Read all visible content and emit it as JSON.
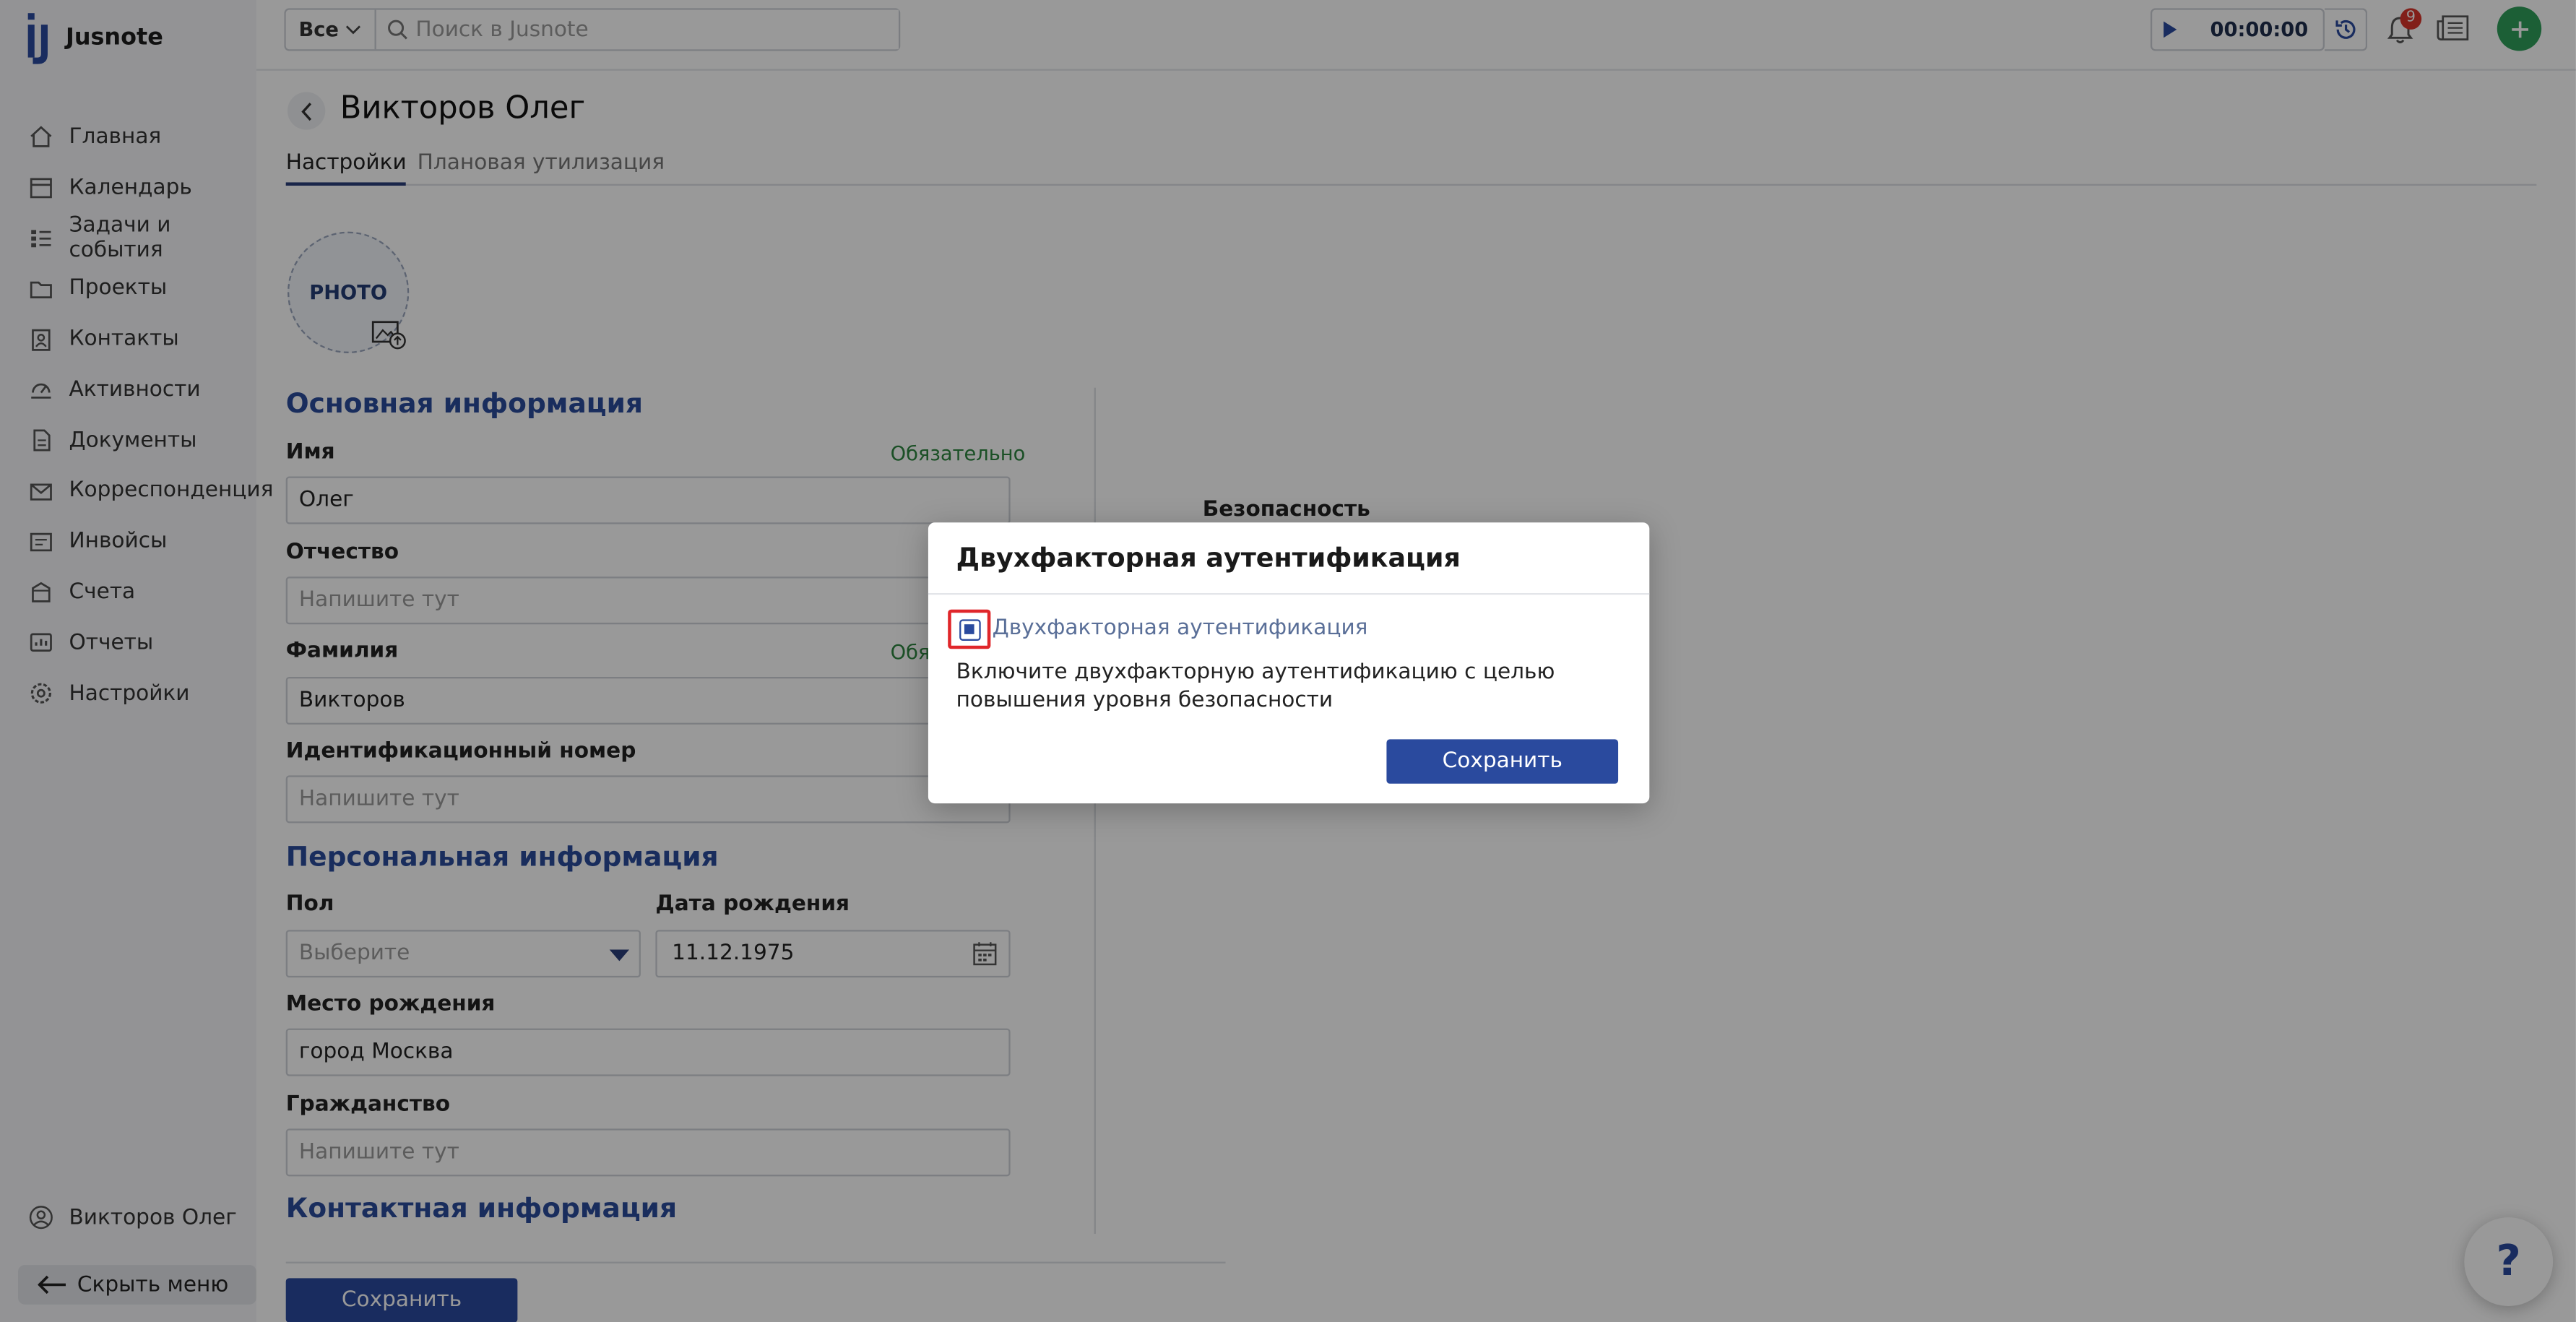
{
  "app": {
    "name": "Jusnote"
  },
  "sidebar": {
    "items": [
      {
        "label": "Главная",
        "icon": "home-icon"
      },
      {
        "label": "Календарь",
        "icon": "calendar-icon"
      },
      {
        "label": "Задачи и события",
        "icon": "tasks-icon"
      },
      {
        "label": "Проекты",
        "icon": "folder-icon"
      },
      {
        "label": "Контакты",
        "icon": "contacts-icon"
      },
      {
        "label": "Активности",
        "icon": "activity-icon"
      },
      {
        "label": "Документы",
        "icon": "documents-icon"
      },
      {
        "label": "Корреспонденция",
        "icon": "mail-icon"
      },
      {
        "label": "Инвойсы",
        "icon": "invoice-icon"
      },
      {
        "label": "Счета",
        "icon": "bank-icon"
      },
      {
        "label": "Отчеты",
        "icon": "reports-icon"
      },
      {
        "label": "Настройки",
        "icon": "gear-icon"
      }
    ],
    "user_name": "Викторов Олег",
    "hide_menu_label": "Скрыть меню"
  },
  "topbar": {
    "search_scope": "Все",
    "search_placeholder": "Поиск в Jusnote",
    "timer": "00:00:00",
    "notifications_count": "9"
  },
  "page": {
    "title": "Викторов Олег",
    "tabs": [
      {
        "label": "Настройки",
        "active": true
      },
      {
        "label": "Плановая утилизация",
        "active": false
      }
    ],
    "photo_label": "PHOTO"
  },
  "form": {
    "section_basic": "Основная информация",
    "first_name_label": "Имя",
    "required_label": "Обязательно",
    "first_name_value": "Олег",
    "middle_name_label": "Отчество",
    "placeholder": "Напишите тут",
    "last_name_label": "Фамилия",
    "required_partial": "Обя",
    "last_name_value": "Викторов",
    "id_number_label": "Идентификационный номер",
    "section_personal": "Персональная информация",
    "gender_label": "Пол",
    "gender_placeholder": "Выберите",
    "birth_date_label": "Дата рождения",
    "birth_date_value": "11.12.1975",
    "birth_place_label": "Место рождения",
    "birth_place_value": "город Москва",
    "citizenship_label": "Гражданство",
    "section_contact": "Контактная информация",
    "save_label": "Сохранить"
  },
  "right_panel": {
    "security_label": "Безопасность"
  },
  "help": {
    "label": "?"
  },
  "modal": {
    "title": "Двухфакторная аутентификация",
    "checkbox_label": "Двухфакторная аутентификация",
    "checkbox_checked": true,
    "description": "Включите двухфакторную аутентификацию с целью повышения уровня безопасности",
    "save_label": "Сохранить"
  },
  "colors": {
    "brand": "#2a4a9e",
    "section_heading": "#2b4b9b",
    "required_text": "#2e8540",
    "add_button": "#2f9e5a",
    "badge": "#d9342b",
    "highlight_frame": "#e0262a"
  }
}
